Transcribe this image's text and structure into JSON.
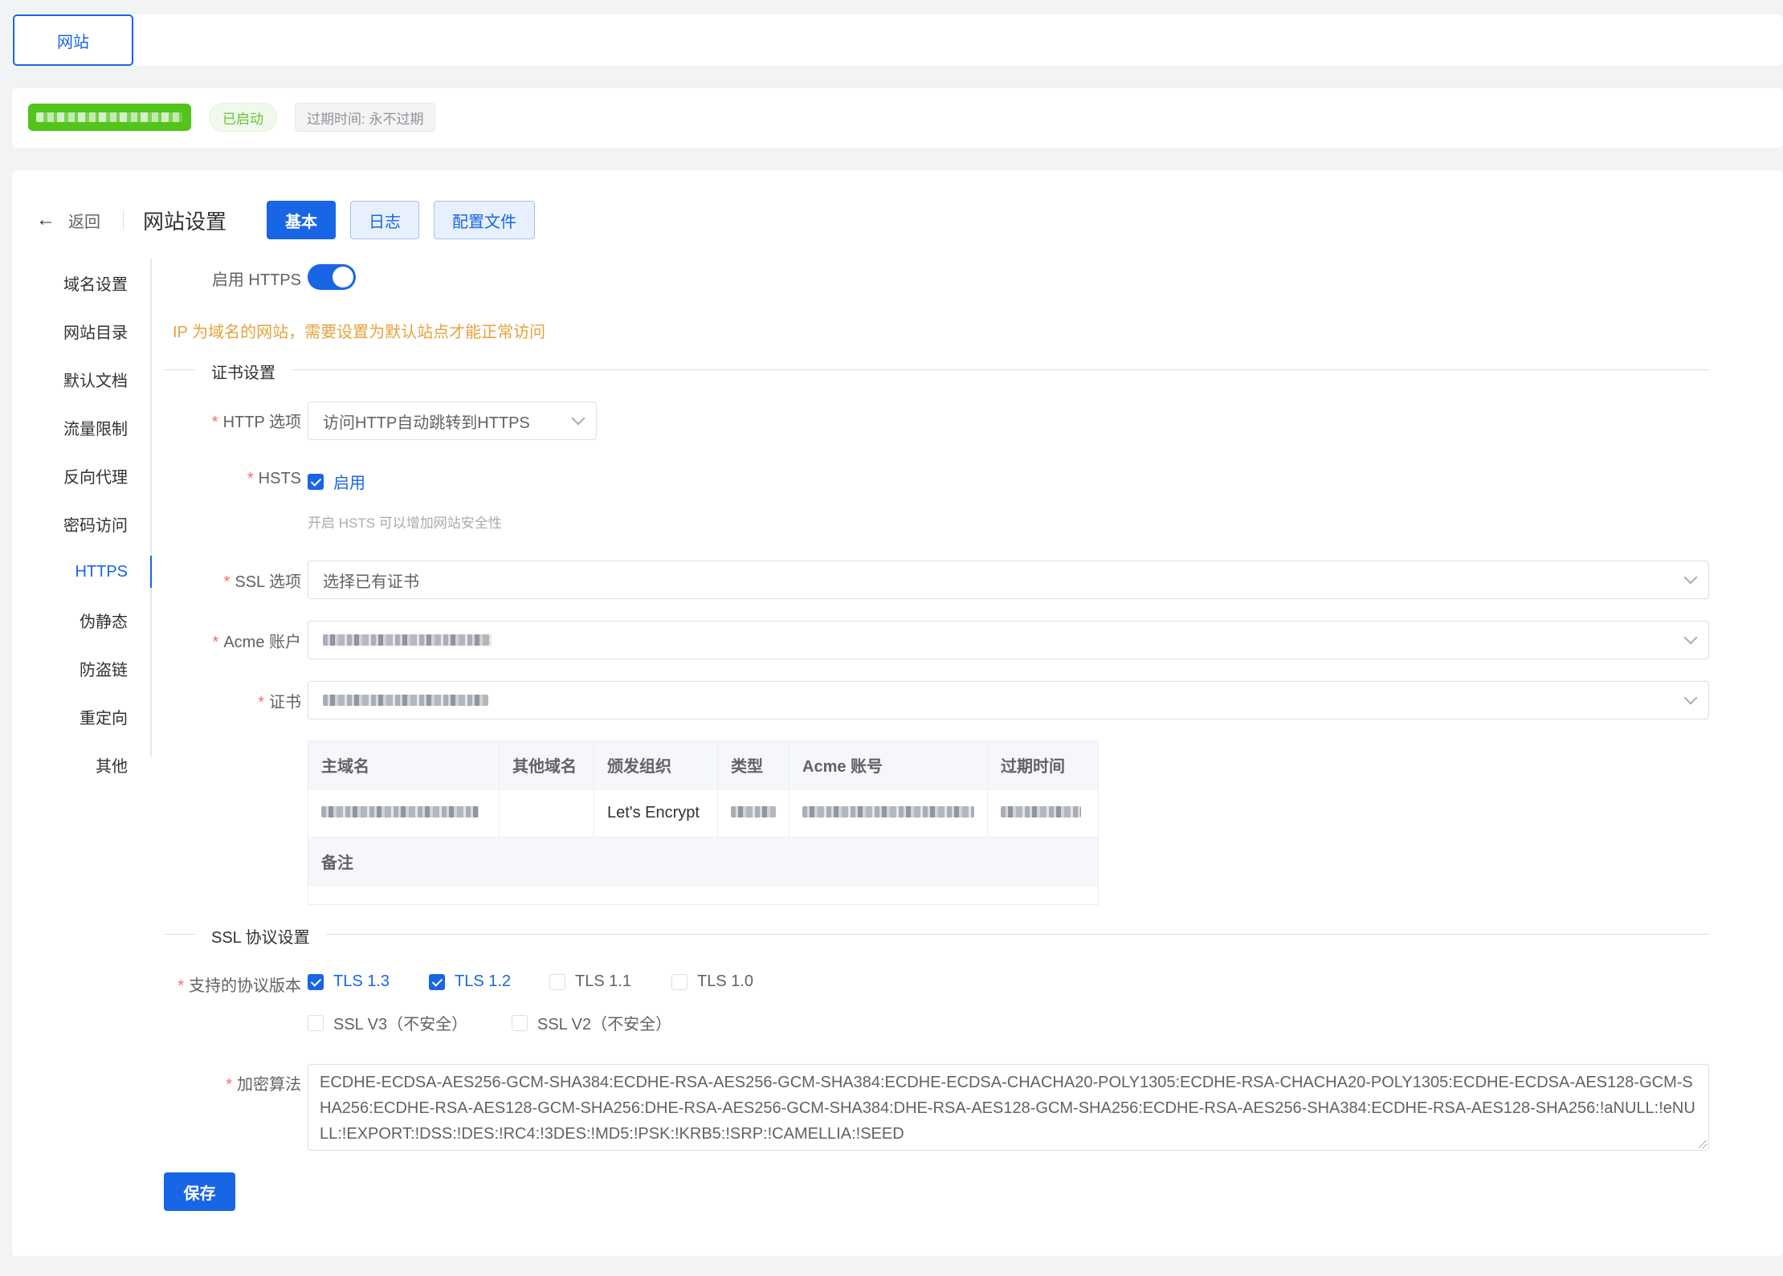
{
  "topbar": {
    "site_tab_label": "网站"
  },
  "infobar": {
    "status": "已启动",
    "expire": "过期时间: 永不过期"
  },
  "header": {
    "back_label": "返回",
    "title": "网站设置",
    "tabs": [
      {
        "label": "基本",
        "active": true
      },
      {
        "label": "日志",
        "active": false
      },
      {
        "label": "配置文件",
        "active": false
      }
    ]
  },
  "sidebar": {
    "items": [
      {
        "label": "域名设置"
      },
      {
        "label": "网站目录"
      },
      {
        "label": "默认文档"
      },
      {
        "label": "流量限制"
      },
      {
        "label": "反向代理"
      },
      {
        "label": "密码访问"
      },
      {
        "label": "HTTPS",
        "active": true
      },
      {
        "label": "伪静态"
      },
      {
        "label": "防盗链"
      },
      {
        "label": "重定向"
      },
      {
        "label": "其他"
      }
    ]
  },
  "form": {
    "enable_https_label": "启用 HTTPS",
    "enable_https": true,
    "ip_warning": "IP 为域名的网站，需要设置为默认站点才能正常访问",
    "cert_section_title": "证书设置",
    "http_option_label": "HTTP 选项",
    "http_option_value": "访问HTTP自动跳转到HTTPS",
    "hsts_label": "HSTS",
    "hsts_checkbox_label": "启用",
    "hsts_hint": "开启 HSTS 可以增加网站安全性",
    "ssl_option_label": "SSL 选项",
    "ssl_option_value": "选择已有证书",
    "acme_label": "Acme 账户",
    "cert_label": "证书",
    "ssl_protocol_section_title": "SSL 协议设置",
    "protocol_label": "支持的协议版本",
    "protocols": [
      {
        "label": "TLS 1.3",
        "checked": true
      },
      {
        "label": "TLS 1.2",
        "checked": true
      },
      {
        "label": "TLS 1.1",
        "checked": false
      },
      {
        "label": "TLS 1.0",
        "checked": false
      },
      {
        "label": "SSL V3（不安全）",
        "checked": false
      },
      {
        "label": "SSL V2（不安全）",
        "checked": false
      }
    ],
    "cipher_label": "加密算法",
    "cipher_value": "ECDHE-ECDSA-AES256-GCM-SHA384:ECDHE-RSA-AES256-GCM-SHA384:ECDHE-ECDSA-CHACHA20-POLY1305:ECDHE-RSA-CHACHA20-POLY1305:ECDHE-ECDSA-AES128-GCM-SHA256:ECDHE-RSA-AES128-GCM-SHA256:DHE-RSA-AES256-GCM-SHA384:DHE-RSA-AES128-GCM-SHA256:ECDHE-RSA-AES256-SHA384:ECDHE-RSA-AES128-SHA256:!aNULL:!eNULL:!EXPORT:!DSS:!DES:!RC4:!3DES:!MD5:!PSK:!KRB5:!SRP:!CAMELLIA:!SEED",
    "save_label": "保存"
  },
  "cert_table": {
    "headers": [
      "主域名",
      "其他域名",
      "颁发组织",
      "类型",
      "Acme 账号",
      "过期时间"
    ],
    "row": {
      "issuer": "Let's Encrypt"
    },
    "note_label": "备注"
  },
  "colors": {
    "primary": "#1865e6",
    "success": "#52c41a",
    "warning": "#e6a23c",
    "required": "#f56c6c"
  }
}
